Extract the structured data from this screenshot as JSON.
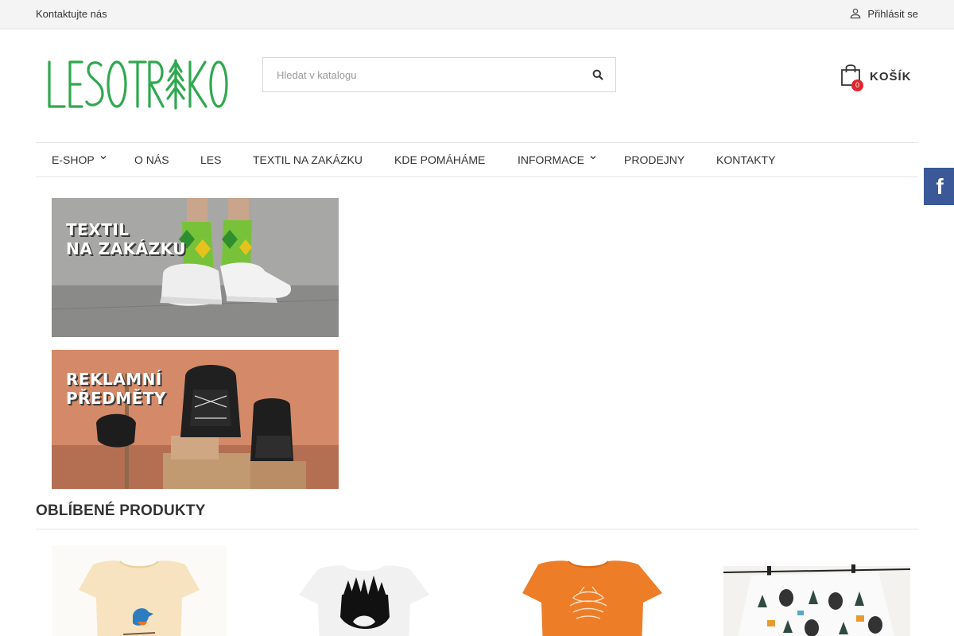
{
  "topbar": {
    "contact_label": "Kontaktujte nás",
    "login_label": "Přihlásit se",
    "login_icon": "user-icon"
  },
  "header": {
    "logo_text": "LESOTRIKO",
    "search_placeholder": "Hledat v katalogu",
    "search_icon": "search-icon",
    "cart_label": "KOŠÍK",
    "cart_count": "0",
    "cart_icon": "shopping-bag-icon"
  },
  "nav": {
    "items": [
      {
        "label": "E-SHOP",
        "has_dropdown": true
      },
      {
        "label": "O NÁS",
        "has_dropdown": false
      },
      {
        "label": "LES",
        "has_dropdown": false
      },
      {
        "label": "TEXTIL NA ZAKÁZKU",
        "has_dropdown": false
      },
      {
        "label": "KDE POMÁHÁME",
        "has_dropdown": false
      },
      {
        "label": "INFORMACE",
        "has_dropdown": true
      },
      {
        "label": "PRODEJNY",
        "has_dropdown": false
      },
      {
        "label": "KONTAKTY",
        "has_dropdown": false
      }
    ]
  },
  "social": {
    "facebook_glyph": "f",
    "icon": "facebook-icon"
  },
  "banners": [
    {
      "line1": "TEXTIL",
      "line2": "NA ZAKÁZKU"
    },
    {
      "line1": "REKLAMNÍ",
      "line2": "PŘEDMĚTY"
    }
  ],
  "section": {
    "title": "OBLÍBENÉ PRODUKTY"
  },
  "colors": {
    "brand_green": "#2fa84f",
    "badge_red": "#e0262e",
    "facebook_blue": "#3b5998",
    "text": "#333333"
  }
}
